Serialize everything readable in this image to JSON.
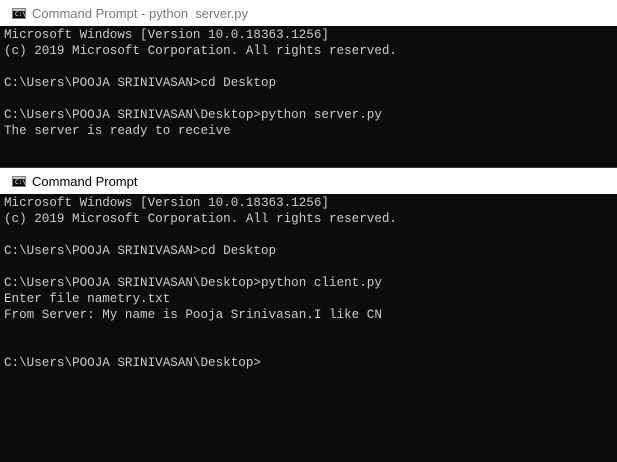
{
  "windows": [
    {
      "title": "Command Prompt - python  server.py",
      "lines": [
        "Microsoft Windows [Version 10.0.18363.1256]",
        "(c) 2019 Microsoft Corporation. All rights reserved.",
        "",
        "C:\\Users\\POOJA SRINIVASAN>cd Desktop",
        "",
        "C:\\Users\\POOJA SRINIVASAN\\Desktop>python server.py",
        "The server is ready to receive"
      ]
    },
    {
      "title": "Command Prompt",
      "lines": [
        "Microsoft Windows [Version 10.0.18363.1256]",
        "(c) 2019 Microsoft Corporation. All rights reserved.",
        "",
        "C:\\Users\\POOJA SRINIVASAN>cd Desktop",
        "",
        "C:\\Users\\POOJA SRINIVASAN\\Desktop>python client.py",
        "Enter file nametry.txt",
        "From Server: My name is Pooja Srinivasan.I like CN",
        "",
        "",
        "C:\\Users\\POOJA SRINIVASAN\\Desktop>"
      ]
    }
  ],
  "icon": {
    "name": "cmd-icon",
    "glyph": "C:\\"
  },
  "colors": {
    "console_bg": "#0c0c0c",
    "console_text": "#cccccc",
    "titlebar_bg": "#ffffff"
  }
}
